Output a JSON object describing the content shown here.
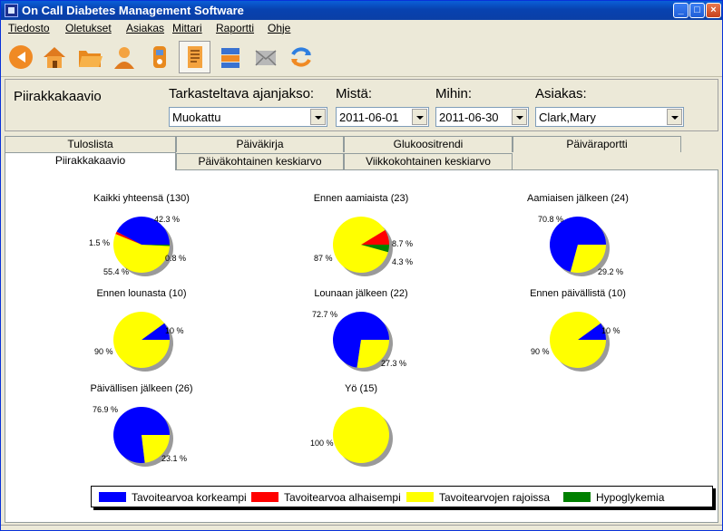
{
  "window": {
    "title": "On Call Diabetes Management Software"
  },
  "menu": [
    "Tiedosto",
    "Oletukset",
    "Asiakas",
    "Mittari",
    "Raportti",
    "Ohje"
  ],
  "toolbar": [
    "back-arrow-icon",
    "home-icon",
    "folder-icon",
    "user-icon",
    "meter-icon",
    "report-icon",
    "layers-icon",
    "mail-icon",
    "refresh-icon"
  ],
  "header": {
    "section_title": "Piirakkakaavio",
    "period_label": "Tarkasteltava ajanjakso:",
    "period_value": "Muokattu",
    "from_label": "Mistä:",
    "from_value": "2011-06-01",
    "to_label": "Mihin:",
    "to_value": "2011-06-30",
    "client_label": "Asiakas:",
    "client_value": "Clark,Mary"
  },
  "tabs_row1": [
    "Tuloslista",
    "Päiväkirja",
    "Glukoositrendi",
    "Päiväraportti"
  ],
  "tabs_row2": [
    "Piirakkakaavio",
    "Päiväkohtainen keskiarvo",
    "Viikkokohtainen keskiarvo"
  ],
  "colors": {
    "high": "#0000ff",
    "low": "#ff0000",
    "in_range": "#ffff00",
    "hypo": "#008000"
  },
  "chart_data": [
    {
      "type": "pie",
      "title": "Kaikki yhteensä (130)",
      "values": [
        42.3,
        1.5,
        55.4,
        0.8
      ],
      "labels": [
        "42.3 %",
        "1.5 %",
        "55.4 %",
        "0.8 %"
      ]
    },
    {
      "type": "pie",
      "title": "Ennen aamiaista (23)",
      "values": [
        0,
        8.7,
        87,
        4.3
      ],
      "labels": [
        "",
        "8.7 %",
        "87 %",
        "4.3 %"
      ]
    },
    {
      "type": "pie",
      "title": "Aamiaisen jälkeen (24)",
      "values": [
        70.8,
        0,
        29.2,
        0
      ],
      "labels": [
        "70.8 %",
        "",
        "29.2 %",
        ""
      ]
    },
    {
      "type": "pie",
      "title": "Ennen lounasta (10)",
      "values": [
        10,
        0,
        90,
        0
      ],
      "labels": [
        "10 %",
        "",
        "90 %",
        ""
      ]
    },
    {
      "type": "pie",
      "title": "Lounaan jälkeen (22)",
      "values": [
        72.7,
        0,
        27.3,
        0
      ],
      "labels": [
        "72.7 %",
        "",
        "27.3 %",
        ""
      ]
    },
    {
      "type": "pie",
      "title": "Ennen päivällistä (10)",
      "values": [
        10,
        0,
        90,
        0
      ],
      "labels": [
        "10 %",
        "",
        "90 %",
        ""
      ]
    },
    {
      "type": "pie",
      "title": "Päivällisen jälkeen (26)",
      "values": [
        76.9,
        0,
        23.1,
        0
      ],
      "labels": [
        "76.9 %",
        "",
        "23.1 %",
        ""
      ]
    },
    {
      "type": "pie",
      "title": "Yö (15)",
      "values": [
        0,
        0,
        100,
        0
      ],
      "labels": [
        "",
        "",
        "100 %",
        ""
      ]
    }
  ],
  "legend": [
    "Tavoitearvoa korkeampi",
    "Tavoitearvoa alhaisempi",
    "Tavoitearvojen rajoissa",
    "Hypoglykemia"
  ]
}
